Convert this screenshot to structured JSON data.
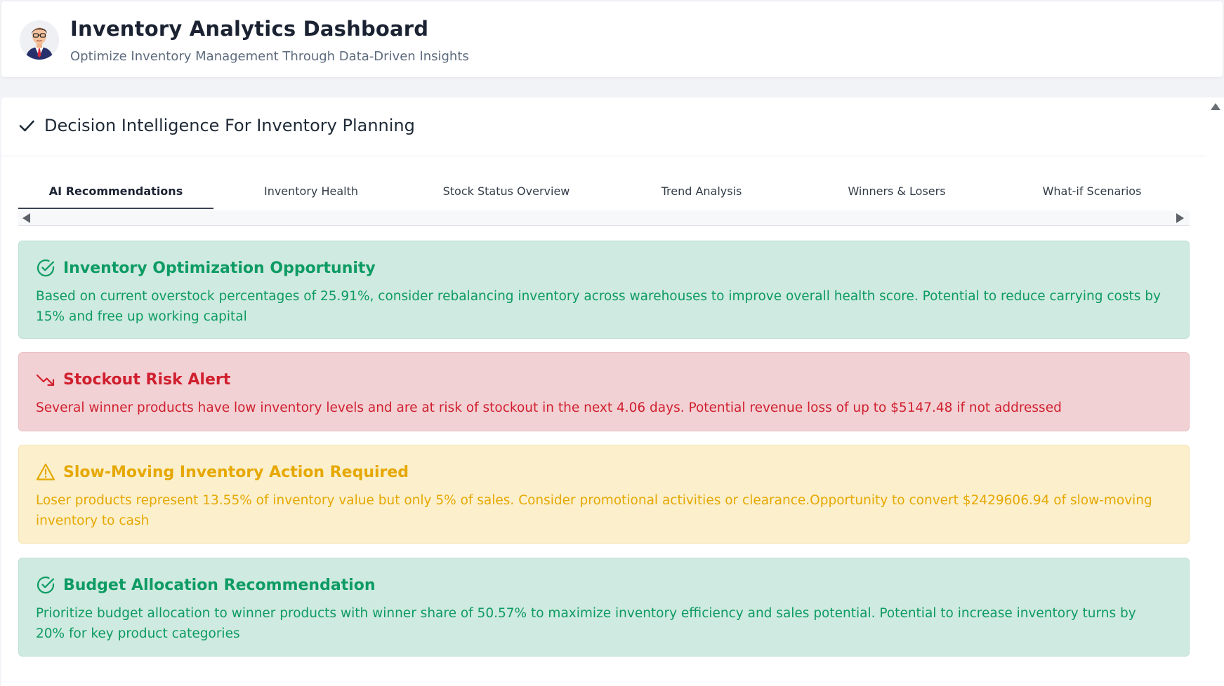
{
  "header": {
    "title": "Inventory Analytics Dashboard",
    "subtitle": "Optimize Inventory Management Through Data-Driven Insights",
    "avatar_icon": "businessman-avatar"
  },
  "panel": {
    "title": "Decision Intelligence For Inventory Planning",
    "title_icon": "check-icon"
  },
  "tabs": [
    {
      "label": "AI Recommendations",
      "active": true
    },
    {
      "label": "Inventory Health",
      "active": false
    },
    {
      "label": "Stock Status Overview",
      "active": false
    },
    {
      "label": "Trend Analysis",
      "active": false
    },
    {
      "label": "Winners & Losers",
      "active": false
    },
    {
      "label": "What-if Scenarios",
      "active": false
    }
  ],
  "cards": [
    {
      "type": "success",
      "icon": "check-circle-icon",
      "title": "Inventory Optimization Opportunity",
      "body": "Based on current overstock percentages of 25.91%, consider rebalancing inventory across warehouses to improve overall health score. Potential to reduce carrying costs by 15% and free up working capital"
    },
    {
      "type": "danger",
      "icon": "trending-down-icon",
      "title": "Stockout Risk Alert",
      "body": "Several winner products have low inventory levels and are at risk of stockout in the next 4.06 days. Potential revenue loss of up to $5147.48 if not addressed"
    },
    {
      "type": "warning",
      "icon": "warning-triangle-icon",
      "title": "Slow-Moving Inventory Action Required",
      "body": "Loser products represent 13.55% of inventory value but only 5% of sales. Consider promotional activities or clearance.Opportunity to convert $2429606.94 of slow-moving inventory to cash"
    },
    {
      "type": "success",
      "icon": "check-circle-icon",
      "title": "Budget Allocation Recommendation",
      "body": "Prioritize budget allocation to winner products with winner share of 50.57% to maximize inventory efficiency and sales potential. Potential to increase inventory turns by 20% for key product categories"
    }
  ],
  "colors": {
    "success": "#0d9b64",
    "success_bg": "#cfeae0",
    "danger": "#d01f2e",
    "danger_bg": "#f2d1d4",
    "warning": "#e6a800",
    "warning_bg": "#fbefcc"
  }
}
